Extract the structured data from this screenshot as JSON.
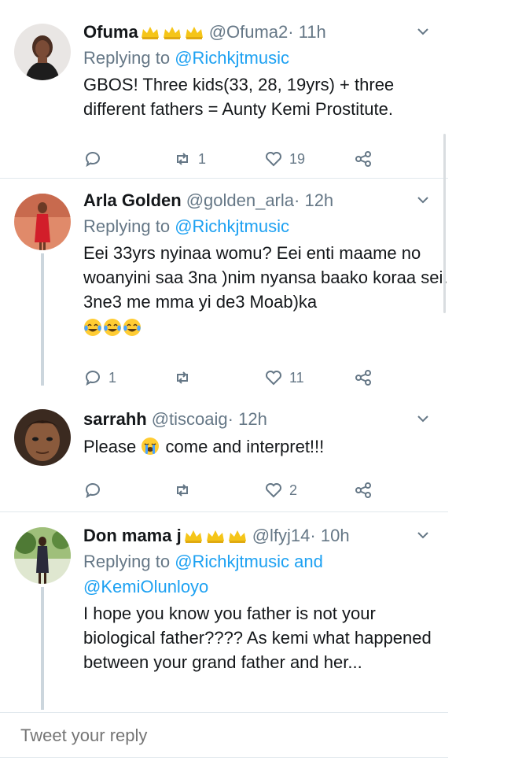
{
  "tweets": [
    {
      "display_name": "Ofuma",
      "badge_count": 3,
      "handle": "@Ofuma2",
      "time": " · 11h",
      "replying_prefix": "Replying to ",
      "replying_to": "@Richkjtmusic",
      "text": "GBOS! Three kids(33, 28, 19yrs) + three different fathers = Aunty Kemi Prostitute.",
      "reply_count": "",
      "retweet_count": "1",
      "like_count": "19",
      "avatar_icon": "profile-photo-woman"
    },
    {
      "display_name": "Arla Golden",
      "handle": "@golden_arla",
      "time": " · 12h",
      "replying_prefix": "Replying to ",
      "replying_to": "@Richkjtmusic",
      "text": "Eei 33yrs nyinaa womu? Eei enti maame no woanyini saa 3na )nim nyansa baako koraa sei. 3ne3 me mma yi de3 Moab)ka",
      "emojis": [
        "tears-of-joy",
        "tears-of-joy",
        "tears-of-joy"
      ],
      "reply_count": "1",
      "retweet_count": "",
      "like_count": "11",
      "avatar_icon": "profile-photo-red-dress"
    },
    {
      "display_name": "sarrahh",
      "handle": "@tiscoaig",
      "time": " · 12h",
      "text_before": "Please ",
      "text_emoji": "loudly-crying",
      "text_after": " come and interpret!!!",
      "reply_count": "",
      "retweet_count": "",
      "like_count": "2",
      "avatar_icon": "profile-photo-face"
    },
    {
      "display_name": "Don mama j",
      "badge_count": 3,
      "handle": "@lfyj14",
      "time": " · 10h",
      "replying_prefix": "Replying to ",
      "replying_to": "@Richkjtmusic",
      "replying_and": " and",
      "replying_to_2": "@KemiOlunloyo",
      "text": "I hope you know you father is not your biological father????  As kemi what happened between your grand father and her...",
      "avatar_icon": "profile-photo-outdoor"
    }
  ],
  "reply_box": {
    "placeholder": "Tweet your reply"
  },
  "colors": {
    "link": "#1da1f2",
    "muted": "#657786",
    "text": "#14171a",
    "divider": "#e1e8ed",
    "badge": "#f5c518"
  }
}
